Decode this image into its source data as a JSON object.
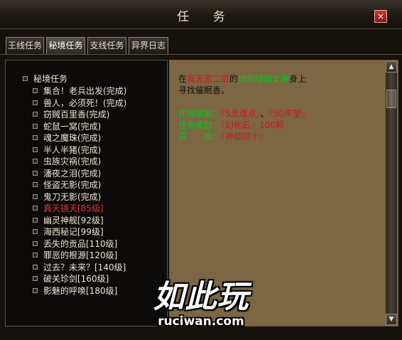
{
  "window": {
    "title": "任 务",
    "close_glyph": "×"
  },
  "tabs": [
    "王线任务",
    "秘境任务",
    "支线任务",
    "异界日志"
  ],
  "active_tab": "秘境任务",
  "tree": {
    "root": "秘境任务",
    "items": [
      "集合！老兵出发(完成)",
      "兽人，必须死！(完成)",
      "窃贼百里香(完成)",
      "蛇鼠一窝(完成)",
      "魂之魔珠(完成)",
      "半人半猪(完成)",
      "虫族灾祸(完成)",
      "潘夜之泪(完成)",
      "怪盗无影(完成)",
      "鬼刀无影(完成)",
      "真天镜天[85级]",
      "幽灵神舰[92级]",
      "海西秘记[99级]",
      "丢失的贡品[110级]",
      "罪恶的根源[120级]",
      "过去？未来？[140级]",
      "破关珍剑[160级]",
      "影魅的呼唤[180级]"
    ],
    "selected_index": 10
  },
  "detail": {
    "line1_prefix": "在",
    "line1_place": "真天宫二层",
    "line1_mid": "的",
    "line1_npc": "地牢绿萌女神",
    "line1_suffix": "身上",
    "line2": "寻找催眠香。",
    "reward1_label": "任务奖励：",
    "reward1_a": "『5灵魂点』",
    "reward1_sep": "、",
    "reward1_b": "『50声望』",
    "reward2_label": "任务奖励：",
    "reward2_value": "『幻化石』100颗",
    "unlock_label": "开　　启：",
    "unlock_value": "『神铠铠十』"
  },
  "scrollbar": {
    "up": "▲",
    "down": "▼"
  },
  "watermark": {
    "main": "如此玩",
    "sub": "ruciwan.com"
  },
  "colors": {
    "highlight_red": "#d0161c",
    "highlight_green": "#06c81d",
    "selected_item": "#d8352e"
  }
}
